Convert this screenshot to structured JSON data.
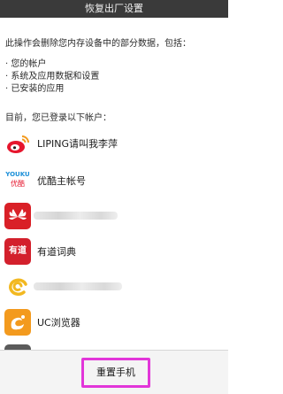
{
  "title": "恢复出厂设置",
  "intro": "此操作会删除您内存设备中的部分数据，包括：",
  "data_items": [
    "· 您的帐户",
    "· 系统及应用数据和设置",
    "· 已安装的应用"
  ],
  "accounts_header": "目前，您已登录以下帐户：",
  "accounts": [
    {
      "icon": "weibo-icon",
      "name": "LIPING请叫我李萍",
      "blurred": false
    },
    {
      "icon": "youku-icon",
      "name": "优酷主帐号",
      "blurred": false,
      "icon_text": "YOUKU",
      "icon_sub": "优酷"
    },
    {
      "icon": "huawei-icon",
      "name": "",
      "blurred": true
    },
    {
      "icon": "youdao-icon",
      "name": "有道词典",
      "blurred": false,
      "icon_text": "有道"
    },
    {
      "icon": "swirl-app-icon",
      "name": "",
      "blurred": true
    },
    {
      "icon": "uc-browser-icon",
      "name": "UC浏览器",
      "blurred": false
    }
  ],
  "reset_button": "重置手机",
  "colors": {
    "titlebar": "#3a3a3a",
    "highlight": "#e236d9",
    "huawei": "#d92027",
    "youdao": "#d3202c",
    "uc": "#f39a1e",
    "swirl": "#f2b820"
  }
}
